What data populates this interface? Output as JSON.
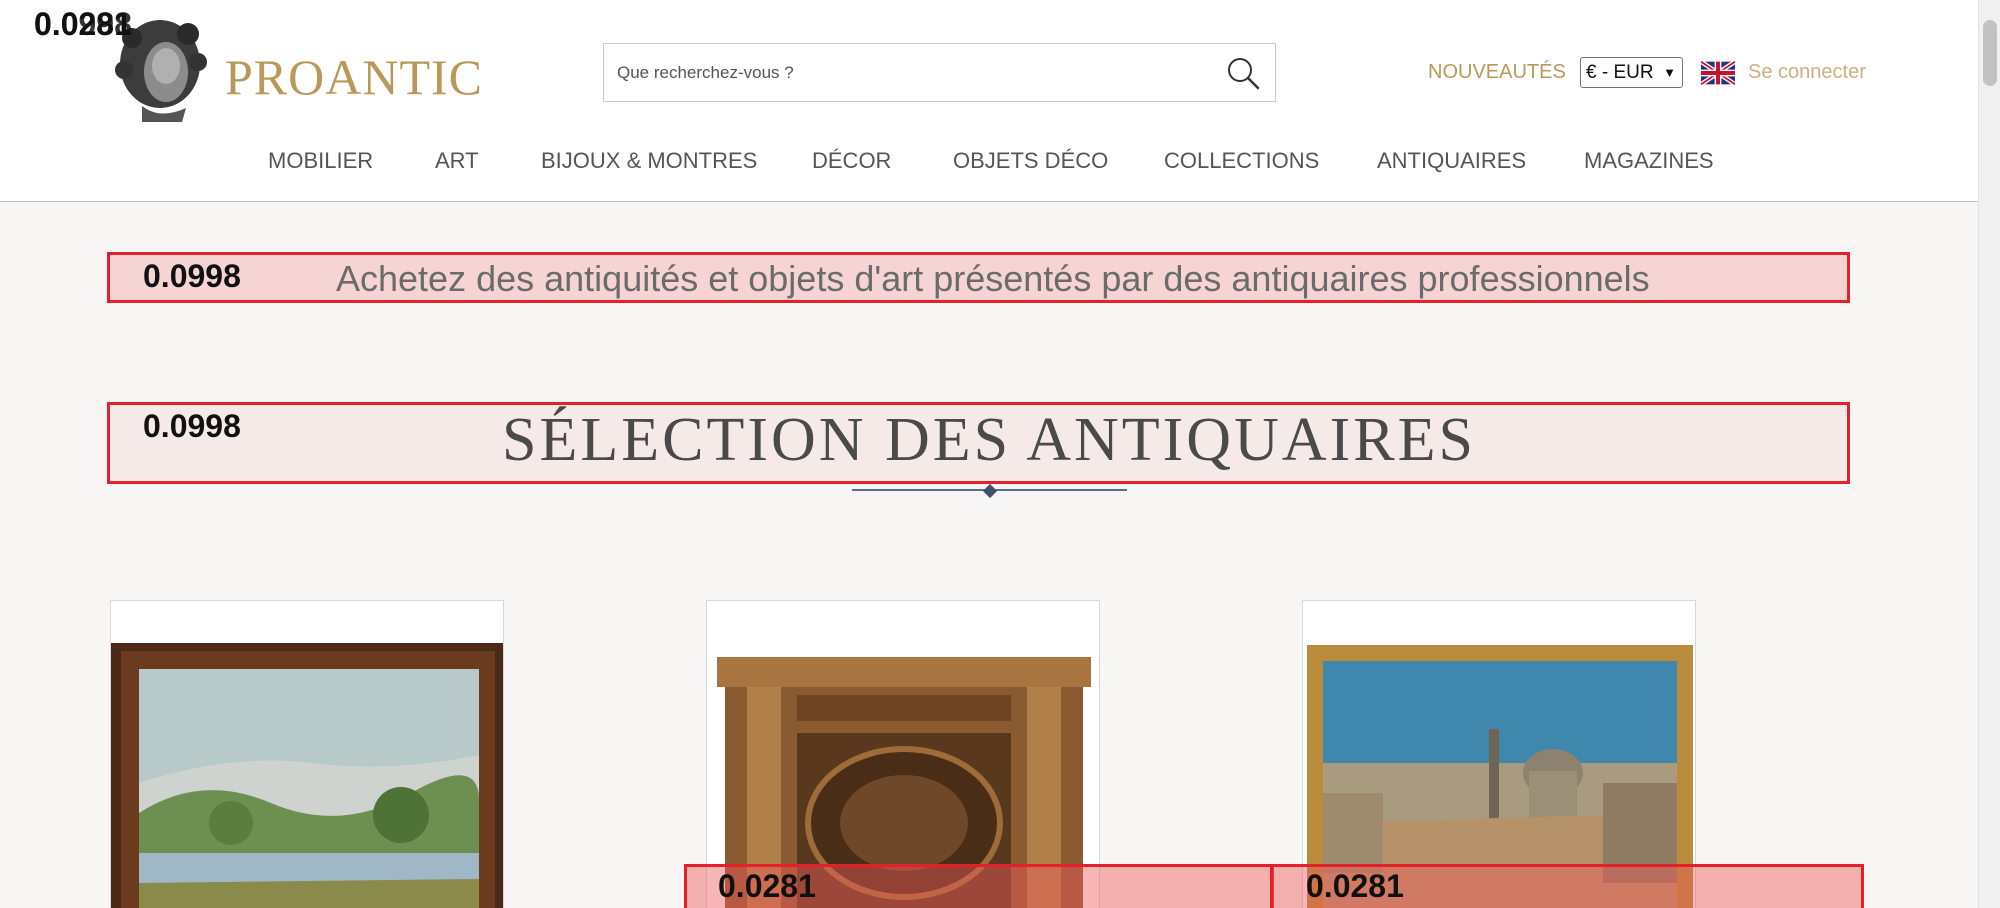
{
  "header": {
    "brand": "PROANTIC",
    "search_placeholder": "Que recherchez-vous ?",
    "nouveautes": "NOUVEAUTÉS",
    "currency": "€ - EUR",
    "login": "Se connecter",
    "icons": [
      "bust-logo",
      "search-icon",
      "uk-flag-icon"
    ]
  },
  "nav": [
    "MOBILIER",
    "ART",
    "BIJOUX & MONTRES",
    "DÉCOR",
    "OBJETS DÉCO",
    "COLLECTIONS",
    "ANTIQUAIRES",
    "MAGAZINES"
  ],
  "tagline": "Achetez des antiquités et objets d'art présentés par des antiquaires professionnels",
  "section_title": "SÉLECTION DES ANTIQUAIRES",
  "overlay_scores": {
    "logo_a": "0.0281",
    "logo_b": "0.0998",
    "tagline": "0.0998",
    "section_title": "0.0998",
    "card_center": "0.0281",
    "card_right": "0.0281"
  },
  "colors": {
    "brand_gold": "#b8995a",
    "highlight_red": "#e4212a",
    "nav_rule": "#5a6f86"
  }
}
